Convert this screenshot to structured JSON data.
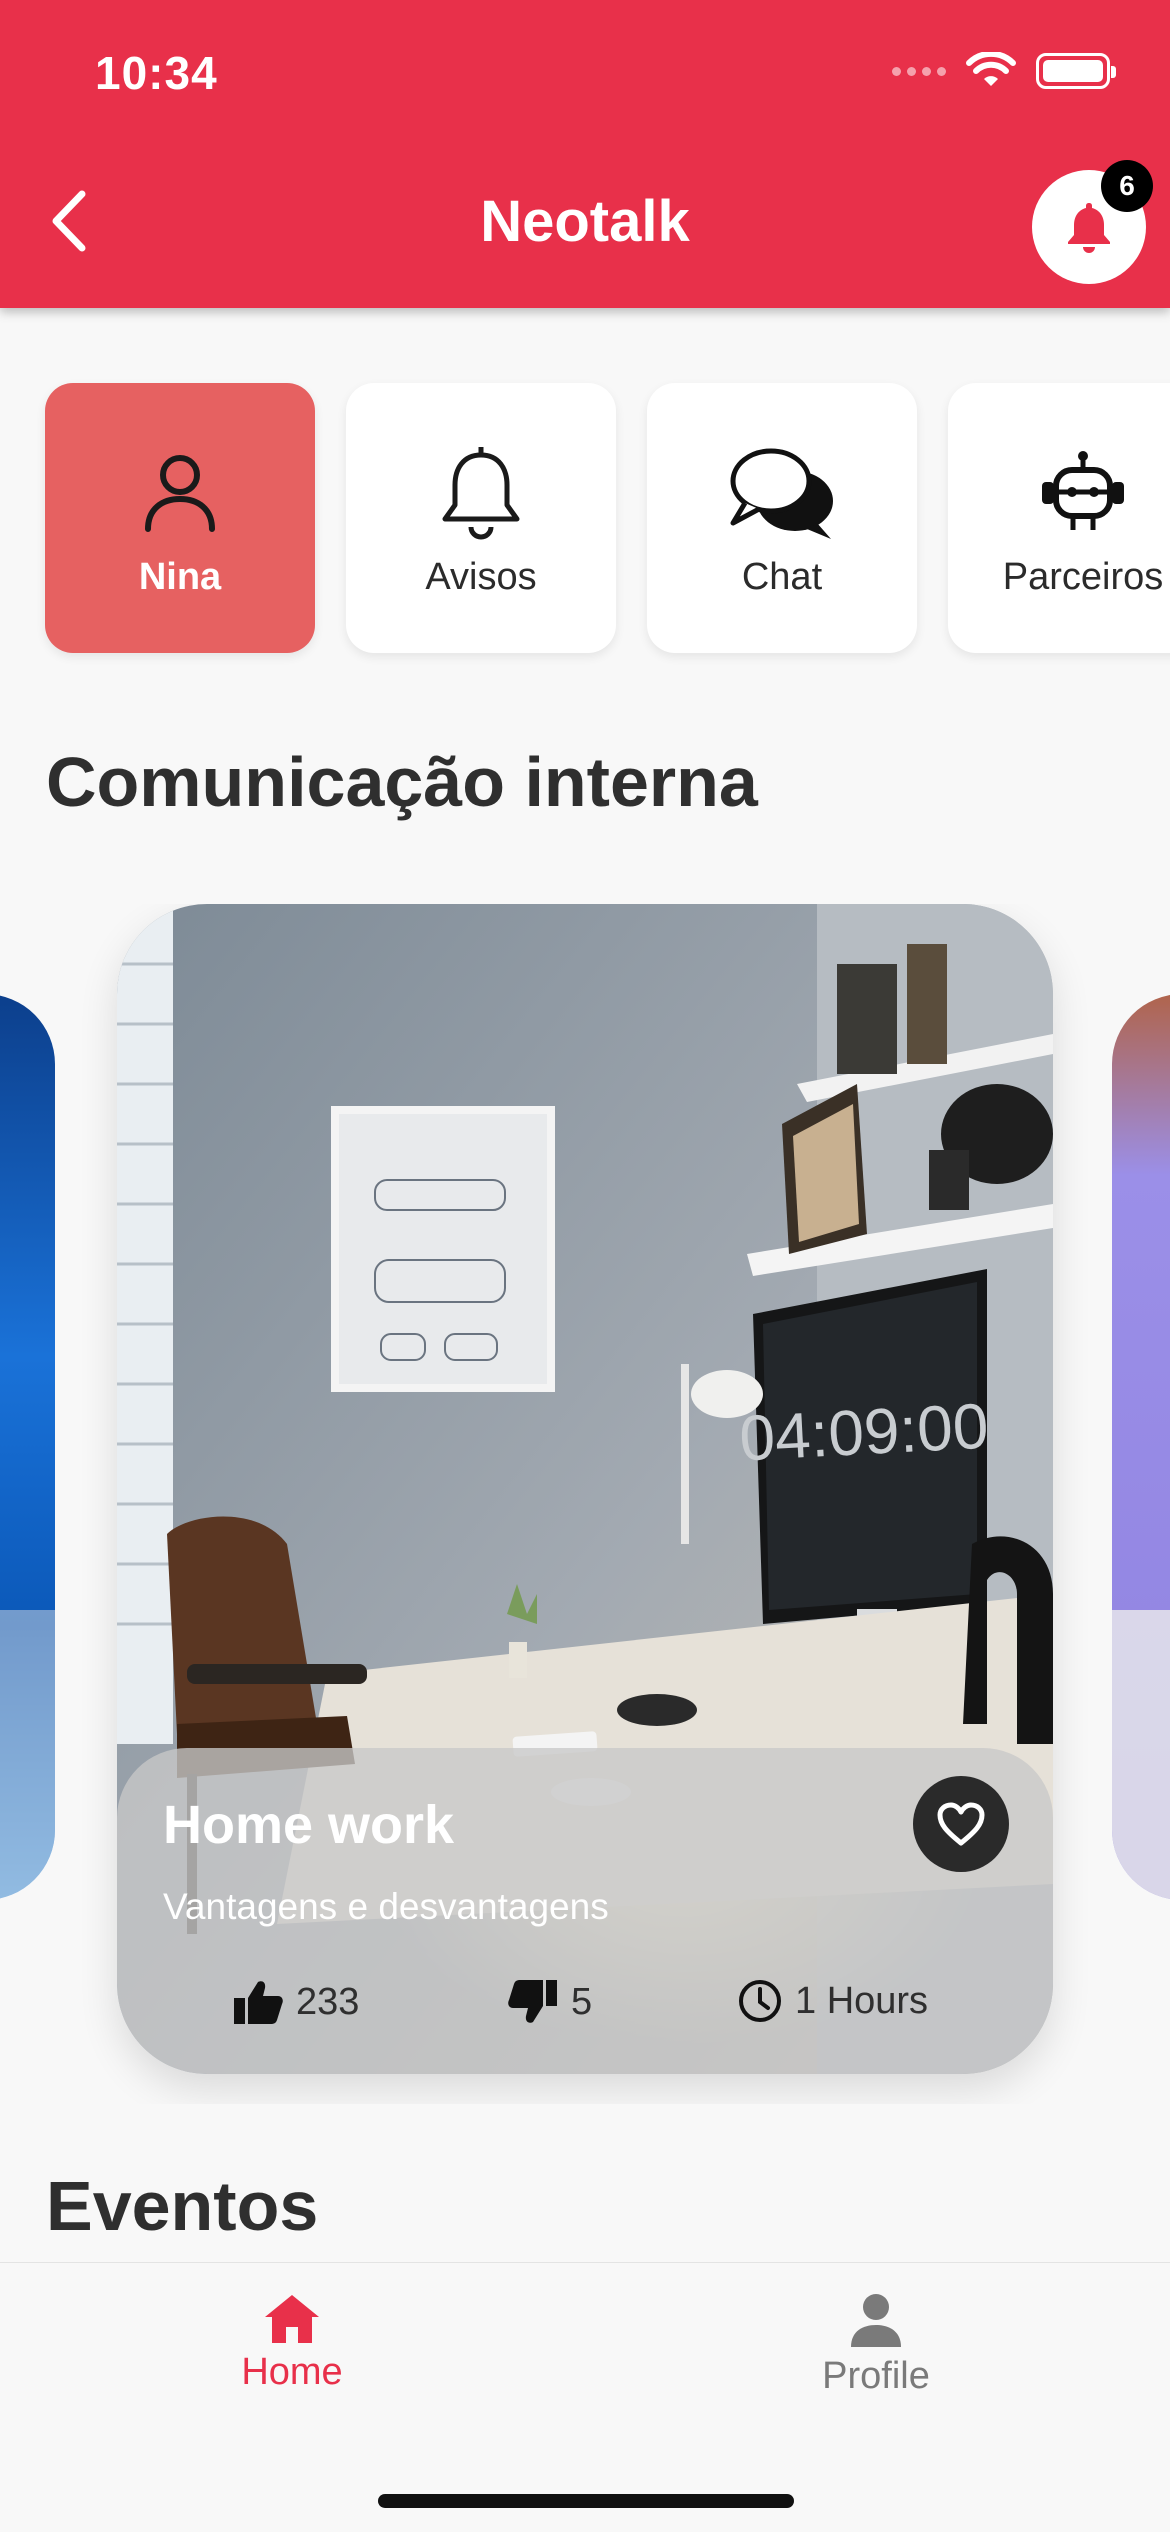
{
  "status_bar": {
    "time": "10:34",
    "icons": [
      "signal-dots-icon",
      "wifi-icon",
      "battery-icon"
    ]
  },
  "header": {
    "title": "Neotalk",
    "back_icon": "chevron-left-icon",
    "notification_icon": "bell-icon",
    "notification_count": "6",
    "color": "#e8304a"
  },
  "categories": [
    {
      "label": "Nina",
      "icon": "person-icon",
      "active": true
    },
    {
      "label": "Avisos",
      "icon": "bell-icon",
      "active": false
    },
    {
      "label": "Chat",
      "icon": "chat-bubbles-icon",
      "active": false
    },
    {
      "label": "Parceiros",
      "icon": "robot-icon",
      "active": false
    }
  ],
  "sections": {
    "internal": "Comunicação interna",
    "events": "Eventos"
  },
  "card": {
    "title": "Home work",
    "subtitle": "Vantagens e desvantagens",
    "likes": "233",
    "dislikes": "5",
    "time": "1 Hours",
    "monitor_clock": "04:09:00",
    "favorite_icon": "heart-outline-icon"
  },
  "bottom_nav": {
    "items": [
      {
        "label": "Home",
        "icon": "home-icon",
        "active": true
      },
      {
        "label": "Profile",
        "icon": "person-icon",
        "active": false
      }
    ],
    "active_color": "#e8304a",
    "inactive_color": "#7a7a7a"
  }
}
